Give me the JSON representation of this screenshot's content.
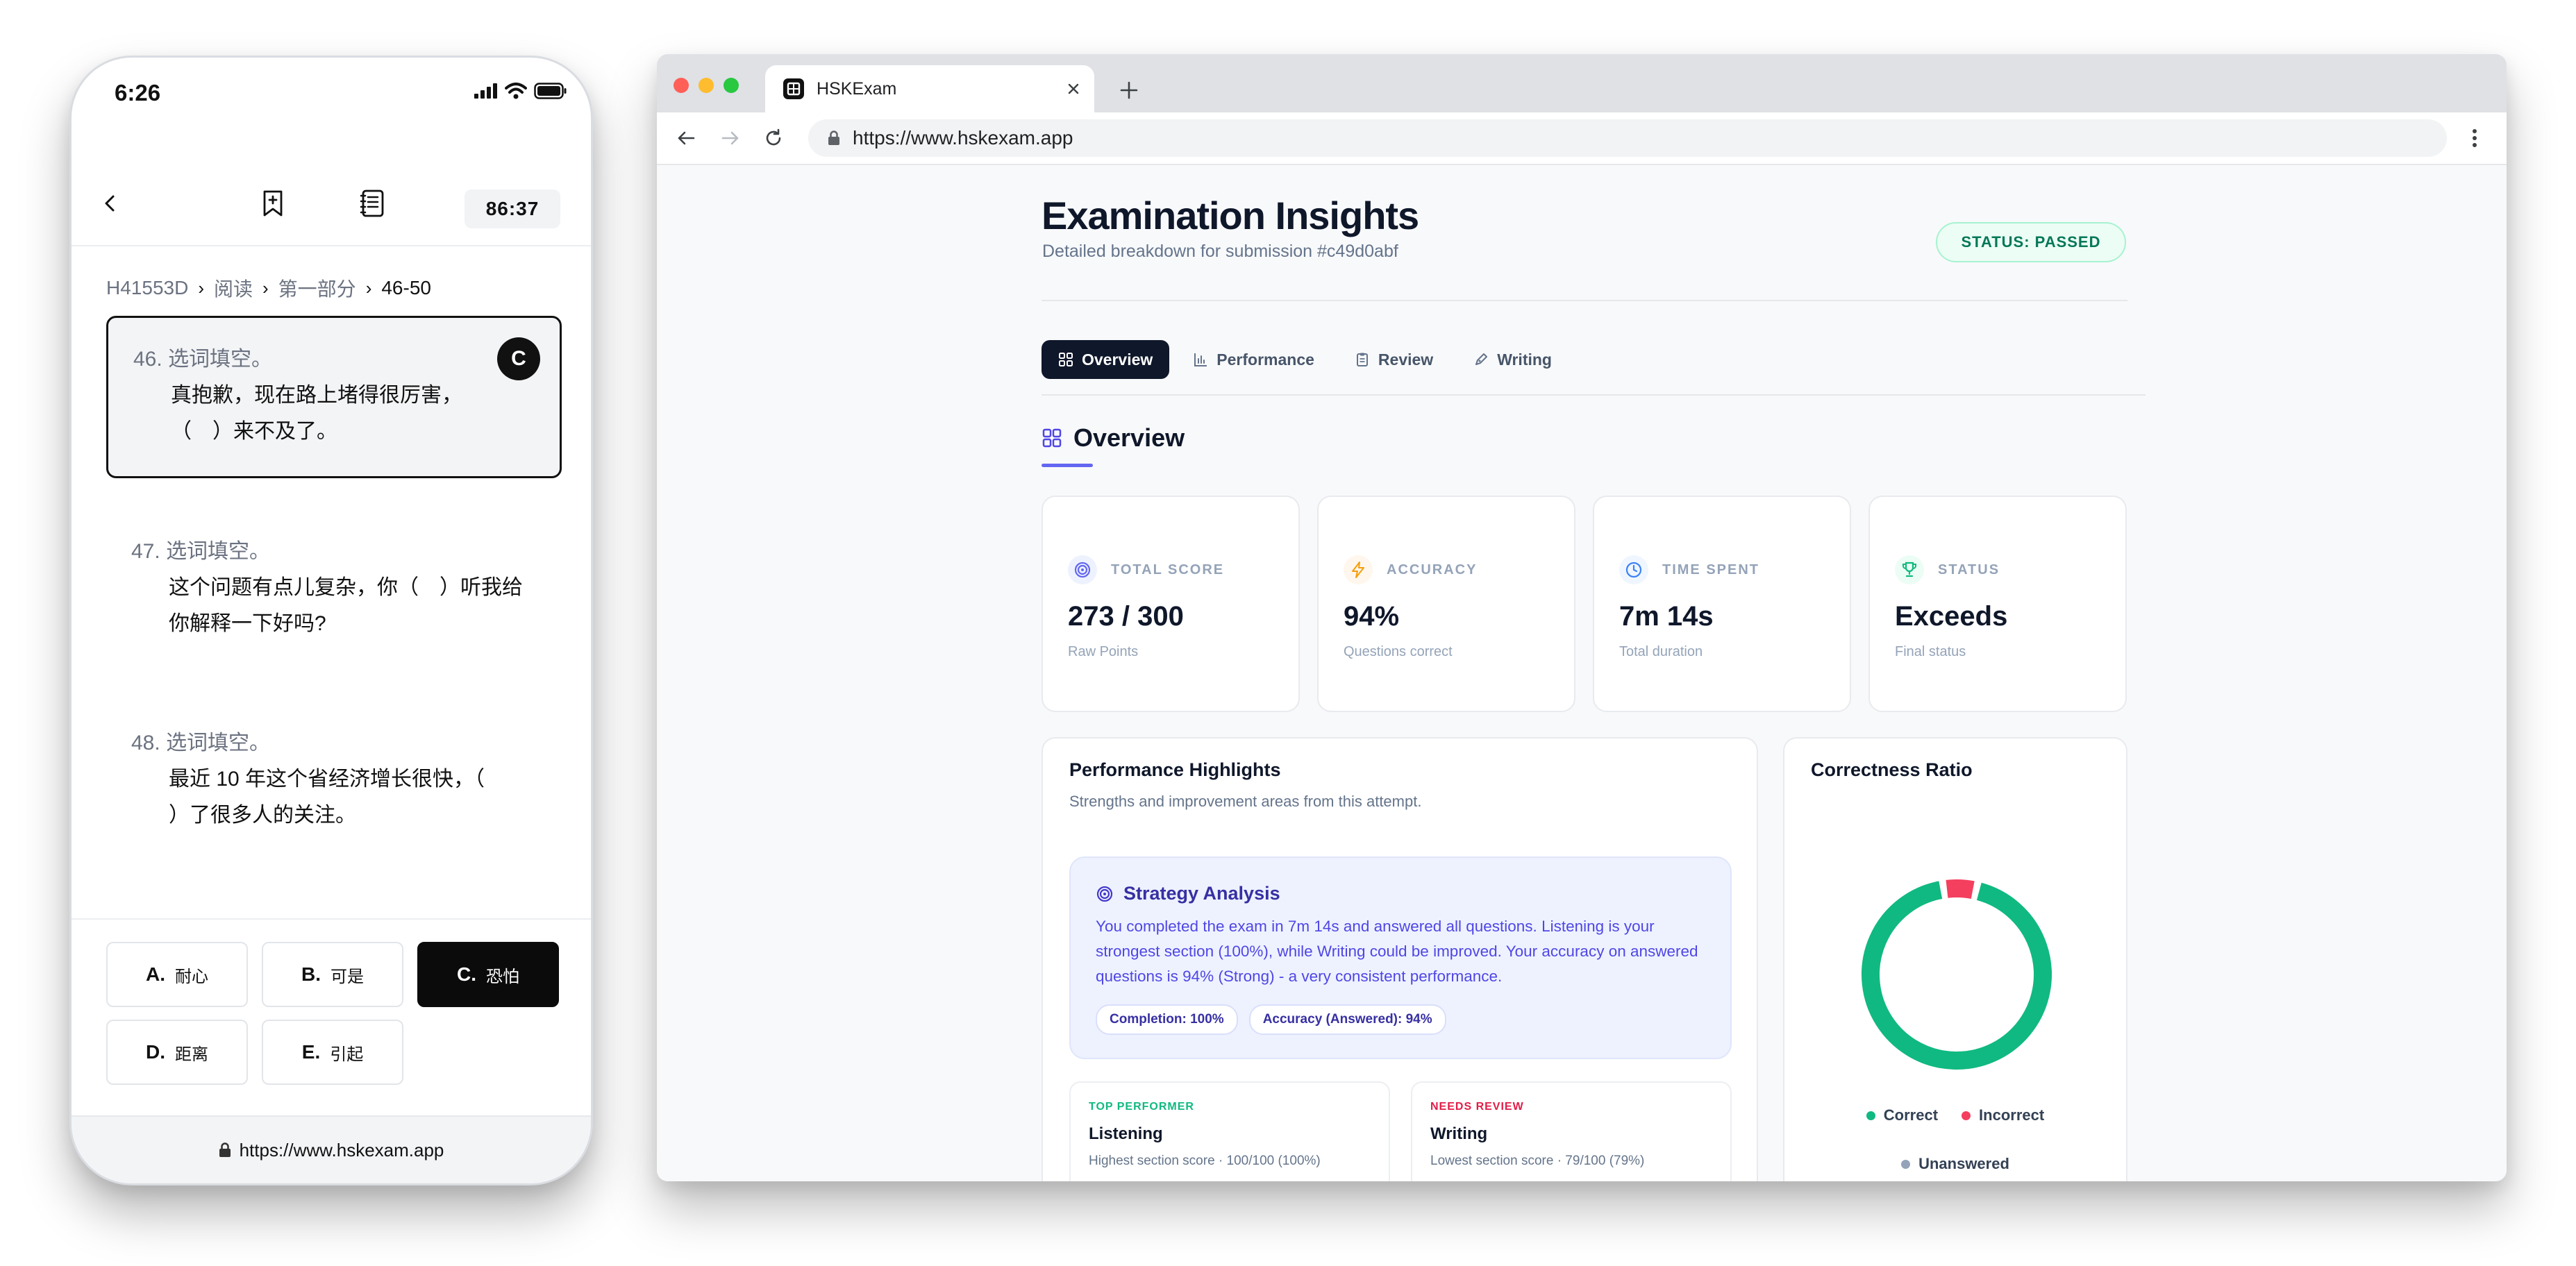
{
  "phone": {
    "status_time": "6:26",
    "timer": "86:37",
    "breadcrumb": [
      "H41553D",
      "阅读",
      "第一部分",
      "46-50"
    ],
    "questions": [
      {
        "num": "46.",
        "prompt": "选词填空。",
        "line1": "真抱歉，现在路上堵得很厉害，",
        "line2": "（　）来不及了。",
        "answer": "C"
      },
      {
        "num": "47.",
        "prompt": "选词填空。",
        "line1": "这个问题有点儿复杂，你（　）听我给",
        "line2": "你解释一下好吗?"
      },
      {
        "num": "48.",
        "prompt": "选词填空。",
        "line1": "最近 10 年这个省经济增长很快，（",
        "line2": "）了很多人的关注。"
      }
    ],
    "options": [
      {
        "letter": "A.",
        "word": "耐心"
      },
      {
        "letter": "B.",
        "word": "可是"
      },
      {
        "letter": "C.",
        "word": "恐怕"
      },
      {
        "letter": "D.",
        "word": "距离"
      },
      {
        "letter": "E.",
        "word": "引起"
      }
    ],
    "selected_option": "C",
    "url": "https://www.hskexam.app"
  },
  "browser": {
    "tab_title": "HSKExam",
    "url": "https://www.hskexam.app",
    "traffic_colors": [
      "#ff5f57",
      "#febc2e",
      "#28c840"
    ]
  },
  "page": {
    "title": "Examination Insights",
    "subtitle": "Detailed breakdown for submission #c49d0abf",
    "status_badge": "STATUS: PASSED",
    "tabs": [
      {
        "label": "Overview",
        "icon": "grid-icon"
      },
      {
        "label": "Performance",
        "icon": "bar-chart-icon"
      },
      {
        "label": "Review",
        "icon": "clipboard-icon"
      },
      {
        "label": "Writing",
        "icon": "pen-icon"
      }
    ],
    "active_tab": "Overview",
    "section_title": "Overview",
    "stats": [
      {
        "label": "TOTAL SCORE",
        "value": "273 / 300",
        "sub": "Raw Points",
        "icon": "target-icon",
        "color": "#6366f1",
        "bg": "#eef2ff"
      },
      {
        "label": "ACCURACY",
        "value": "94%",
        "sub": "Questions correct",
        "icon": "lightning-icon",
        "color": "#f59e0b",
        "bg": "#fff7ed"
      },
      {
        "label": "TIME SPENT",
        "value": "7m 14s",
        "sub": "Total duration",
        "icon": "clock-icon",
        "color": "#3b82f6",
        "bg": "#eff6ff"
      },
      {
        "label": "STATUS",
        "value": "Exceeds",
        "sub": "Final status",
        "icon": "trophy-icon",
        "color": "#10b981",
        "bg": "#ecfdf5"
      }
    ],
    "highlights": {
      "title": "Performance Highlights",
      "subtitle": "Strengths and improvement areas from this attempt.",
      "strategy_title": "Strategy Analysis",
      "strategy_text": "You completed the exam in 7m 14s and answered all questions. Listening is your strongest section (100%), while Writing could be improved. Your accuracy on answered questions is 94% (Strong) - a very consistent performance.",
      "tags": [
        "Completion: 100%",
        "Accuracy (Answered): 94%"
      ],
      "top": {
        "kicker": "TOP PERFORMER",
        "title": "Listening",
        "sub": "Highest section score · 100/100 (100%)",
        "color": "#10b981"
      },
      "review": {
        "kicker": "NEEDS REVIEW",
        "title": "Writing",
        "sub": "Lowest section score · 79/100 (79%)",
        "color": "#e11d48"
      }
    },
    "ratio": {
      "title": "Correctness Ratio",
      "legend": [
        {
          "label": "Correct",
          "color": "#10b981"
        },
        {
          "label": "Incorrect",
          "color": "#f43f5e"
        },
        {
          "label": "Unanswered",
          "color": "#94a3b8"
        }
      ]
    }
  },
  "chart_data": {
    "type": "pie",
    "title": "Correctness Ratio",
    "categories": [
      "Correct",
      "Incorrect",
      "Unanswered"
    ],
    "values": [
      94,
      6,
      0
    ],
    "colors": [
      "#10b981",
      "#f43f5e",
      "#94a3b8"
    ],
    "legend_position": "bottom"
  }
}
